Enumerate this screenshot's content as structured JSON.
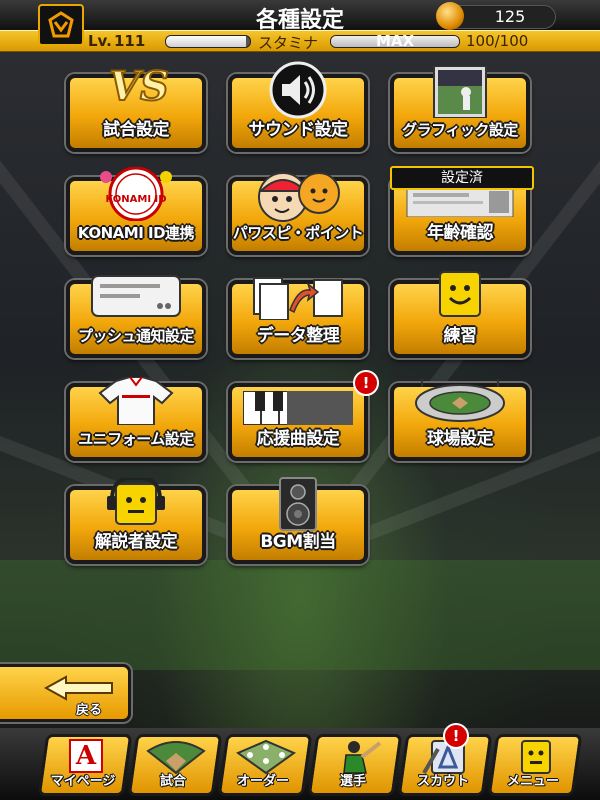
{
  "header": {
    "title": "各種設定",
    "coins": "125",
    "level_prefix": "Lv.",
    "level": "111",
    "stamina_label": "スタミナ",
    "stamina_state": "MAX",
    "stamina_value": "100/100",
    "stamina_fraction": 1.0,
    "level_progress_fraction": 0.95
  },
  "tiles": {
    "match": "試合設定",
    "sound": "サウンド設定",
    "graphics": "グラフィック設定",
    "konami": "KONAMI ID連携",
    "konami_logo": "KONAMI ID",
    "pawapoint": "パワスピ・ポイント",
    "age": "年齢確認",
    "age_badge": "設定済",
    "push": "プッシュ通知設定",
    "data": "データ整理",
    "practice": "練習",
    "uniform": "ユニフォーム設定",
    "cheer": "応援曲設定",
    "stadium": "球場設定",
    "commentator": "解説者設定",
    "bgm": "BGM割当",
    "alert_mark": "!"
  },
  "back": {
    "label": "戻る"
  },
  "nav": {
    "mypage": "マイページ",
    "match": "試合",
    "order": "オーダー",
    "players": "選手",
    "scout": "スカウト",
    "menu": "メニュー",
    "mypage_letter": "A"
  },
  "colors": {
    "accent": "#f2a70b",
    "alert": "#d40000",
    "badge_border": "#f2c500"
  }
}
